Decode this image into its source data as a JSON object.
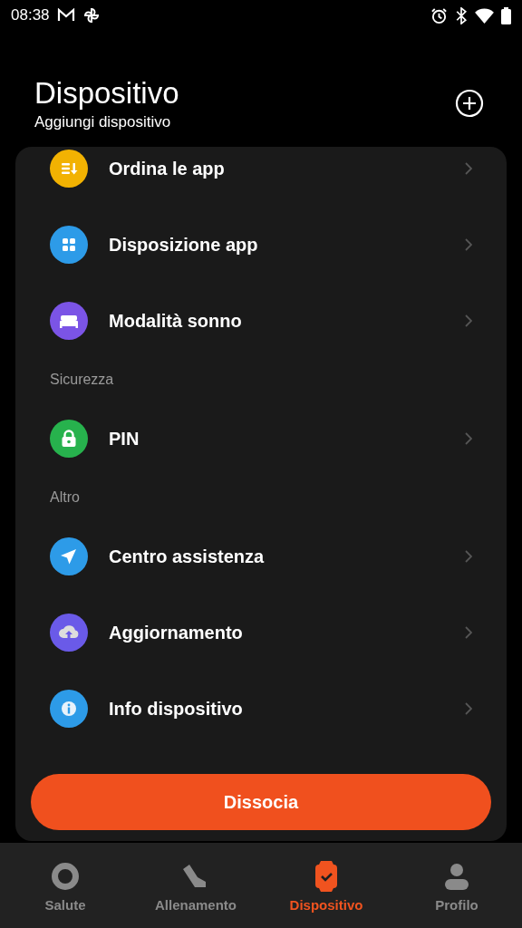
{
  "status_bar": {
    "time": "08:38"
  },
  "header": {
    "title": "Dispositivo",
    "subtitle": "Aggiungi dispositivo"
  },
  "list": [
    {
      "kind": "item",
      "label": "Ordina le app",
      "color": "#f2b202"
    },
    {
      "kind": "item",
      "label": "Disposizione app",
      "color": "#2d9be8"
    },
    {
      "kind": "item",
      "label": "Modalità sonno",
      "color": "#7b54e6"
    },
    {
      "kind": "header",
      "label": "Sicurezza"
    },
    {
      "kind": "item",
      "label": "PIN",
      "color": "#27b24d"
    },
    {
      "kind": "header",
      "label": "Altro"
    },
    {
      "kind": "item",
      "label": "Centro assistenza",
      "color": "#2d9be8"
    },
    {
      "kind": "item",
      "label": "Aggiornamento",
      "color": "#6a5ae8"
    },
    {
      "kind": "item",
      "label": "Info dispositivo",
      "color": "#2d9be8"
    }
  ],
  "action_button": {
    "label": "Dissocia"
  },
  "bottom_nav": [
    {
      "label": "Salute",
      "selected": false
    },
    {
      "label": "Allenamento",
      "selected": false
    },
    {
      "label": "Dispositivo",
      "selected": true
    },
    {
      "label": "Profilo",
      "selected": false
    }
  ]
}
